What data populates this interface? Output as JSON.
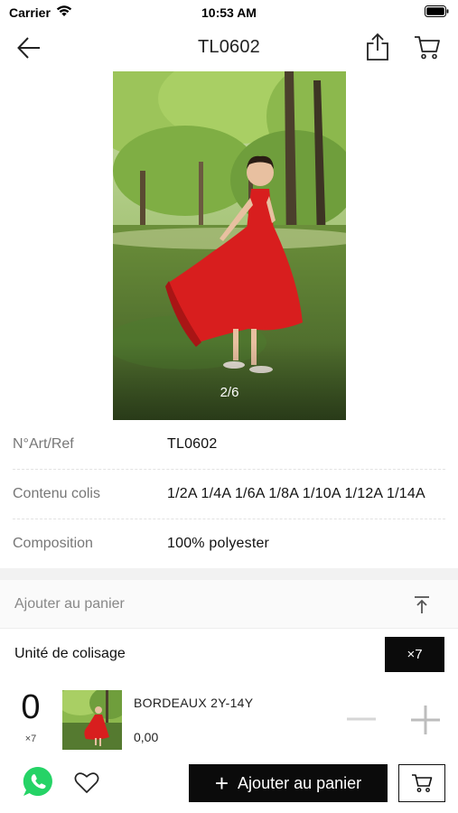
{
  "status_bar": {
    "carrier": "Carrier",
    "time": "10:53 AM",
    "wifi_icon": "wifi-icon",
    "battery_icon": "battery-icon"
  },
  "nav": {
    "title": "TL0602",
    "back_icon": "arrow-left-icon",
    "share_icon": "share-icon",
    "cart_icon": "cart-icon"
  },
  "gallery": {
    "counter": "2/6"
  },
  "details": [
    {
      "label": "N°Art/Ref",
      "value": "TL0602"
    },
    {
      "label": "Contenu colis",
      "value": "1/2A 1/4A 1/6A 1/8A 1/10A 1/12A 1/14A"
    },
    {
      "label": "Composition",
      "value": "100% polyester"
    }
  ],
  "cart_section": {
    "title": "Ajouter au panier",
    "collapse_icon": "collapse-up-icon",
    "packing_label": "Unité de colisage",
    "packing_badge": "×7"
  },
  "variant": {
    "quantity": "0",
    "multiplier": "×7",
    "name": "BORDEAUX 2Y-14Y",
    "price": "0,00"
  },
  "bottom_bar": {
    "add_button_label": "Ajouter au panier",
    "whatsapp_icon": "whatsapp-icon",
    "favorite_icon": "heart-icon"
  },
  "colors": {
    "primary": "#0b0b0b",
    "whatsapp": "#25d366",
    "dress": "#d81e1e"
  }
}
